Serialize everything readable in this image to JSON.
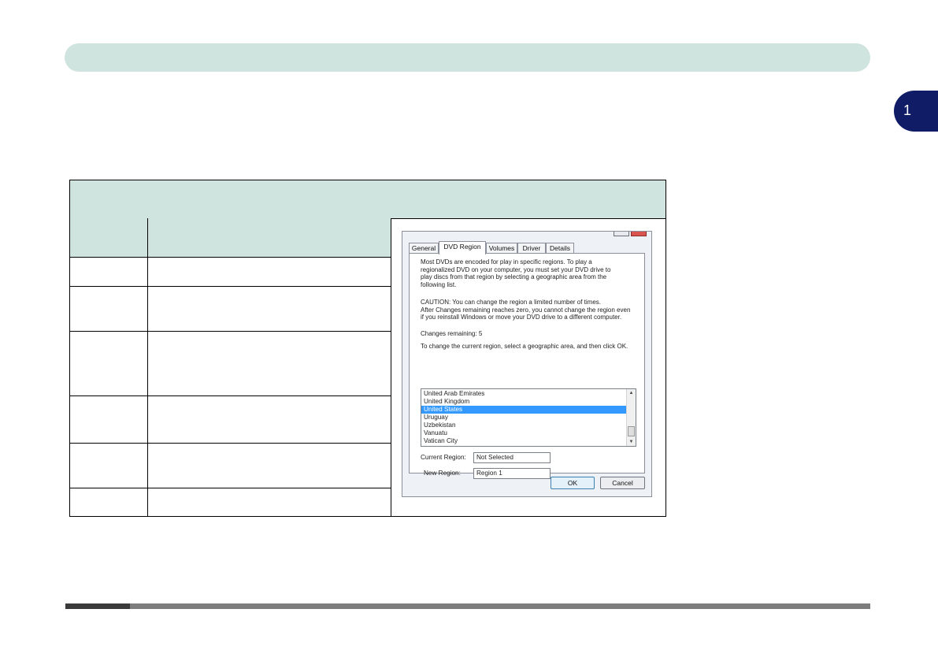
{
  "chapter": {
    "number": "1"
  },
  "dialog": {
    "tabs": [
      {
        "label": "General",
        "active": false
      },
      {
        "label": "DVD Region",
        "active": true
      },
      {
        "label": "Volumes",
        "active": false
      },
      {
        "label": "Driver",
        "active": false
      },
      {
        "label": "Details",
        "active": false
      }
    ],
    "intro": [
      "Most DVDs are encoded for play in specific regions. To play a",
      "regionalized DVD on your computer, you must set your DVD drive to",
      "play discs from that region by selecting a geographic area from the",
      "following list."
    ],
    "caution": [
      "CAUTION:  You can change the region a limited number of times.",
      "After Changes remaining reaches zero, you cannot change the region even",
      "if you reinstall Windows or move your DVD drive to a different computer."
    ],
    "changes_remaining": "Changes remaining: 5",
    "instruction": "To change the current region, select a geographic area, and then click OK.",
    "regions": [
      "United Arab Emirates",
      "United Kingdom",
      "United States",
      "Uruguay",
      "Uzbekistan",
      "Vanuatu",
      "Vatican City"
    ],
    "selected_region": "United States",
    "current_region_label": "Current Region:",
    "current_region_value": "Not Selected",
    "new_region_label": "New Region:",
    "new_region_value": "Region 1",
    "ok_label": "OK",
    "cancel_label": "Cancel"
  }
}
